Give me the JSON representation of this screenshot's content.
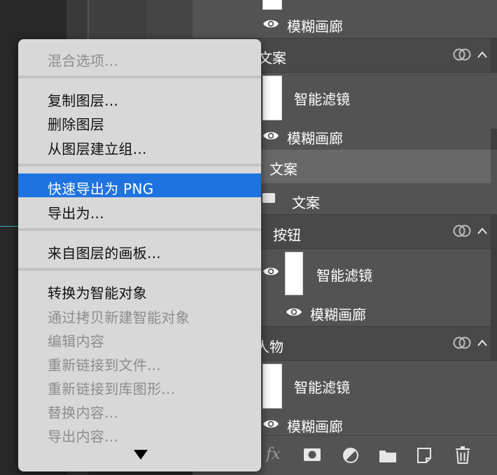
{
  "context_menu": {
    "items": [
      {
        "label": "混合选项...",
        "enabled": false
      },
      {
        "label": "复制图层...",
        "enabled": true
      },
      {
        "label": "删除图层",
        "enabled": true
      },
      {
        "label": "从图层建立组...",
        "enabled": true
      },
      {
        "label": "快速导出为 PNG",
        "enabled": true,
        "highlighted": true
      },
      {
        "label": "导出为...",
        "enabled": true
      },
      {
        "label": "来自图层的画板...",
        "enabled": true
      },
      {
        "label": "转换为智能对象",
        "enabled": true
      },
      {
        "label": "通过拷贝新建智能对象",
        "enabled": false
      },
      {
        "label": "编辑内容",
        "enabled": false
      },
      {
        "label": "重新链接到文件...",
        "enabled": false
      },
      {
        "label": "重新链接到库图形...",
        "enabled": false
      },
      {
        "label": "替换内容...",
        "enabled": false
      },
      {
        "label": "导出内容...",
        "enabled": false
      }
    ],
    "more_icon": "triangle-down-icon",
    "highlight_color": "#1f73e0"
  },
  "layers": {
    "rows": [
      {
        "type": "effect",
        "label": "模糊画廊"
      },
      {
        "type": "group",
        "label": "文案"
      },
      {
        "type": "smart_filter",
        "label": "智能滤镜"
      },
      {
        "type": "effect",
        "label": "模糊画廊"
      },
      {
        "type": "group_selected",
        "label": "文案"
      },
      {
        "type": "layer",
        "label": "文案"
      },
      {
        "type": "group",
        "label": "按钮"
      },
      {
        "type": "smart_filter",
        "label": "智能滤镜"
      },
      {
        "type": "effect",
        "label": "模糊画廊"
      },
      {
        "type": "group",
        "label": "人物"
      },
      {
        "type": "smart_filter",
        "label": "智能滤镜"
      },
      {
        "type": "effect",
        "label": "模糊画廊"
      }
    ],
    "bottom_bar": {
      "fx_label": "fx",
      "icons": [
        "fx-icon",
        "layer-mask-icon",
        "adjustment-layer-icon",
        "new-group-folder-icon",
        "new-layer-icon",
        "trash-icon"
      ]
    }
  }
}
